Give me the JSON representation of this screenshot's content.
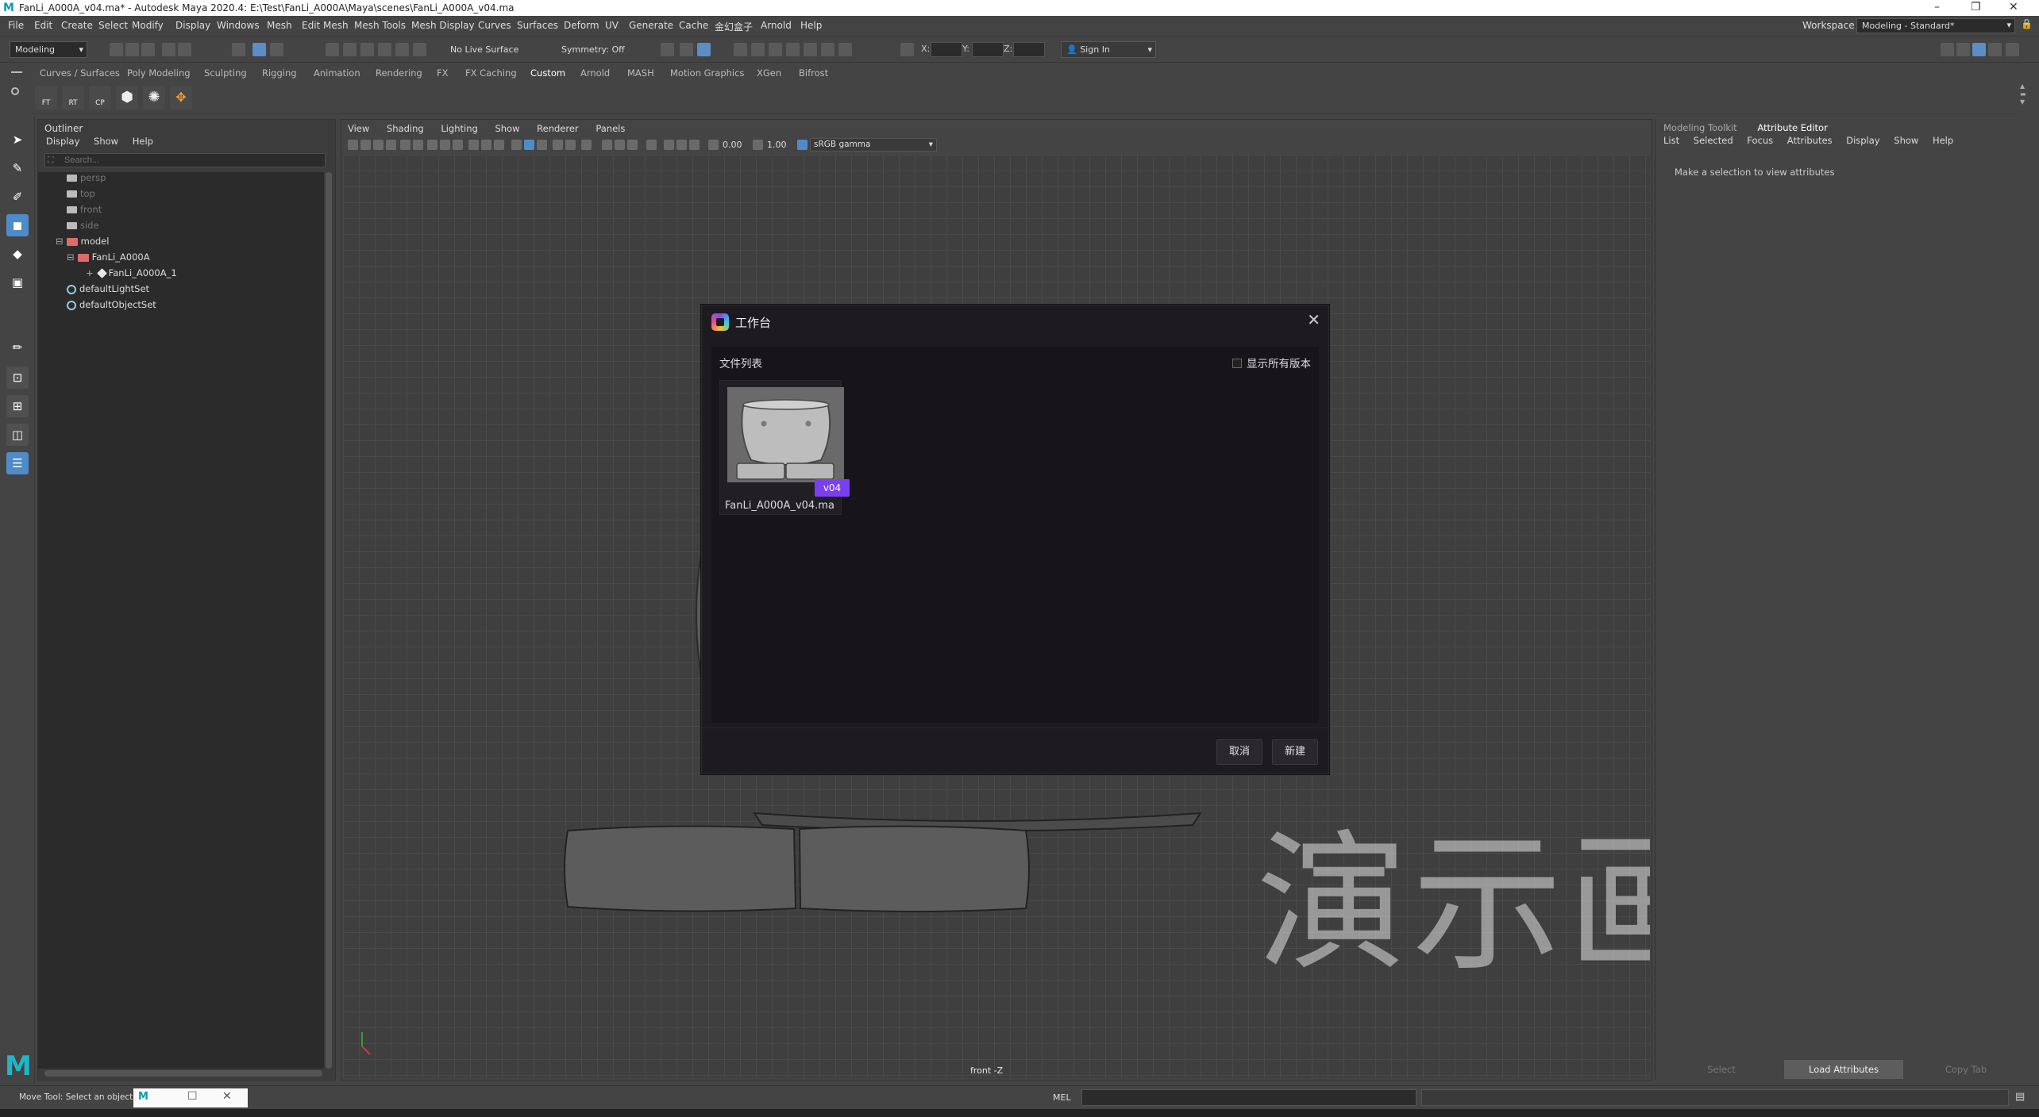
{
  "window": {
    "title": "FanLi_A000A_v04.ma* - Autodesk Maya 2020.4: E:\\Test\\FanLi_A000A\\Maya\\scenes\\FanLi_A000A_v04.ma",
    "logo": "M",
    "minimize": "–",
    "restore": "❐",
    "close": "✕"
  },
  "menubar": {
    "items": [
      "File",
      "Edit",
      "Create",
      "Select",
      "Modify",
      "Display",
      "Windows",
      "Mesh",
      "Edit Mesh",
      "Mesh Tools",
      "Mesh Display",
      "Curves",
      "Surfaces",
      "Deform",
      "UV",
      "Generate",
      "Cache",
      "金幻盒子",
      "Arnold",
      "Help"
    ],
    "workspace_label": "Workspace :",
    "workspace_value": "Modeling - Standard*"
  },
  "statusline": {
    "mode": "Modeling",
    "live_surface": "No Live Surface",
    "symmetry": "Symmetry: Off",
    "x_label": "X:",
    "y_label": "Y:",
    "z_label": "Z:",
    "sign_in": "Sign In"
  },
  "shelf": {
    "tabs": [
      "Curves / Surfaces",
      "Poly Modeling",
      "Sculpting",
      "Rigging",
      "Animation",
      "Rendering",
      "FX",
      "FX Caching",
      "Custom",
      "Arnold",
      "MASH",
      "Motion Graphics",
      "XGen",
      "Bifrost"
    ],
    "active_tab": "Custom",
    "buttons": [
      "FT",
      "RT",
      "CP",
      "",
      ""
    ]
  },
  "outliner": {
    "title": "Outliner",
    "menus": [
      "Display",
      "Show",
      "Help"
    ],
    "search_placeholder": "Search...",
    "rows": [
      {
        "label": "persp",
        "dim": true
      },
      {
        "label": "top",
        "dim": true
      },
      {
        "label": "front",
        "dim": true
      },
      {
        "label": "side",
        "dim": true
      },
      {
        "label": "model",
        "dim": false
      },
      {
        "label": "FanLi_A000A",
        "dim": false
      },
      {
        "label": "FanLi_A000A_1",
        "dim": false
      },
      {
        "label": "defaultLightSet",
        "dim": false
      },
      {
        "label": "defaultObjectSet",
        "dim": false
      }
    ]
  },
  "viewport": {
    "menus": [
      "View",
      "Shading",
      "Lighting",
      "Show",
      "Renderer",
      "Panels"
    ],
    "exposure": "0.00",
    "gamma": "1.00",
    "color_space": "sRGB gamma",
    "camera": "front -Z",
    "watermark": "演示画面"
  },
  "attribute_editor": {
    "tabs": [
      "Modeling Toolkit",
      "Attribute Editor"
    ],
    "active_tab": "Attribute Editor",
    "menus": [
      "List",
      "Selected",
      "Focus",
      "Attributes",
      "Display",
      "Show",
      "Help"
    ],
    "message": "Make a selection to view attributes",
    "buttons": [
      "Select",
      "Load Attributes",
      "Copy Tab"
    ]
  },
  "helpline": {
    "text": "Move Tool: Select an object to d",
    "mel_label": "MEL"
  },
  "dialog": {
    "title": "工作台",
    "file_list_label": "文件列表",
    "show_all_versions": "显示所有版本",
    "file": {
      "name": "FanLi_A000A_v04.ma",
      "version": "v04"
    },
    "cancel": "取消",
    "new": "新建"
  },
  "colors": {
    "accent": "#4f8bc9",
    "version_badge": "#7b3ff0",
    "dialog_bg": "#1d1b20"
  }
}
